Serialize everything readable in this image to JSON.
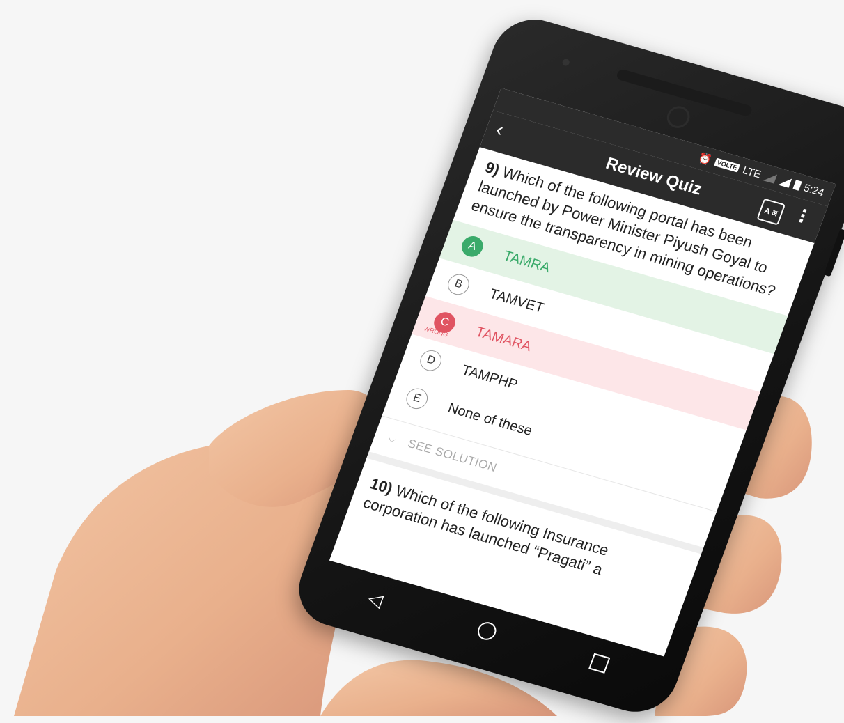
{
  "status_bar": {
    "alarm_icon": "alarm-icon",
    "volte": "VOLTE",
    "network": "LTE",
    "time": "5:24"
  },
  "app_bar": {
    "title": "Review Quiz",
    "back_icon": "chevron-left-icon",
    "translate_label": "A अ",
    "menu_icon": "more-vert-icon"
  },
  "question_1": {
    "number": "9)",
    "text": "Which of the following portal has been launched by Power Minister Piyush Goyal to ensure the transparency in mining operations?",
    "options": [
      {
        "letter": "A",
        "text": "TAMRA",
        "state": "correct"
      },
      {
        "letter": "B",
        "text": "TAMVET",
        "state": "neutral"
      },
      {
        "letter": "C",
        "text": "TAMARA",
        "state": "wrong",
        "tag": "WRONG"
      },
      {
        "letter": "D",
        "text": "TAMPHP",
        "state": "neutral"
      },
      {
        "letter": "E",
        "text": "None of these",
        "state": "neutral"
      }
    ],
    "see_solution": "SEE SOLUTION"
  },
  "question_2": {
    "number": "10)",
    "text": "Which of the following Insurance corporation has launched “Pragati” a"
  },
  "colors": {
    "correct": "#3aaa6a",
    "correct_bg": "#e3f3e5",
    "wrong": "#e05462",
    "wrong_bg": "#fde6e8",
    "appbar": "#2b2b2b"
  }
}
